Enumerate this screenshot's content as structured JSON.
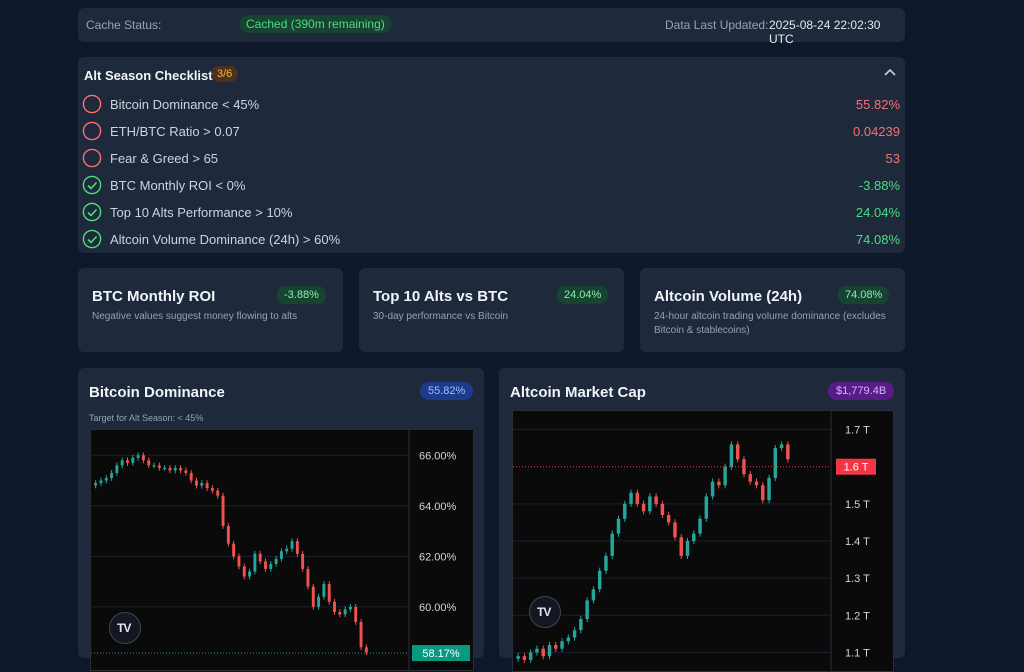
{
  "cache": {
    "status_label": "Cache Status:",
    "status_value": "Cached (390m remaining)",
    "updated_label": "Data Last Updated:",
    "updated_value": "2025-08-24 22:02:30 UTC"
  },
  "checklist": {
    "title": "Alt Season Checklist",
    "count": "3/6",
    "items": [
      {
        "label": "Bitcoin Dominance < 45%",
        "value": "55.82%",
        "met": false
      },
      {
        "label": "ETH/BTC Ratio > 0.07",
        "value": "0.04239",
        "met": false
      },
      {
        "label": "Fear & Greed > 65",
        "value": "53",
        "met": false
      },
      {
        "label": "BTC Monthly ROI < 0%",
        "value": "-3.88%",
        "met": true
      },
      {
        "label": "Top 10 Alts Performance > 10%",
        "value": "24.04%",
        "met": true
      },
      {
        "label": "Altcoin Volume Dominance (24h) > 60%",
        "value": "74.08%",
        "met": true
      }
    ]
  },
  "cards": [
    {
      "title": "BTC Monthly ROI",
      "badge": "-3.88%",
      "desc": "Negative values suggest money flowing to alts"
    },
    {
      "title": "Top 10 Alts vs BTC",
      "badge": "24.04%",
      "desc": "30-day performance vs Bitcoin"
    },
    {
      "title": "Altcoin Volume (24h)",
      "badge": "74.08%",
      "desc": "24-hour altcoin trading volume dominance (excludes Bitcoin & stablecoins)"
    }
  ],
  "btc_dom": {
    "title": "Bitcoin Dominance",
    "badge": "55.82%",
    "subtitle": "Target for Alt Season: < 45%",
    "axis": [
      "66.00%",
      "64.00%",
      "62.00%",
      "60.00%"
    ],
    "last_label": "58.17%",
    "tv_logo": "TV"
  },
  "alt_cap": {
    "title": "Altcoin Market Cap",
    "badge": "$1,779.4B",
    "axis": [
      "1.7 T",
      "1.5 T",
      "1.4 T",
      "1.3 T",
      "1.2 T",
      "1.1 T"
    ],
    "last_label": "1.6 T",
    "tv_logo": "TV"
  },
  "colors": {
    "up": "#26a69a",
    "down": "#ef5350",
    "good": "#4ade80",
    "bad": "#f87171",
    "panel": "#1e293b",
    "bg": "#0f172a"
  },
  "chart_data": [
    {
      "type": "candlestick",
      "title": "Bitcoin Dominance",
      "ylim": [
        57.5,
        67
      ],
      "yticks": [
        66,
        64,
        62,
        60
      ],
      "last": 58.17,
      "close": [
        64.9,
        65.0,
        65.1,
        65.3,
        65.6,
        65.8,
        65.7,
        65.9,
        66.0,
        65.8,
        65.6,
        65.6,
        65.5,
        65.5,
        65.4,
        65.5,
        65.4,
        65.3,
        65.0,
        64.8,
        64.9,
        64.7,
        64.6,
        64.4,
        63.2,
        62.5,
        62.0,
        61.6,
        61.2,
        61.4,
        62.1,
        61.8,
        61.5,
        61.7,
        61.9,
        62.2,
        62.3,
        62.6,
        62.1,
        61.5,
        60.8,
        60.0,
        60.4,
        60.9,
        60.2,
        59.8,
        59.7,
        59.9,
        60.0,
        59.4,
        58.4,
        58.2
      ],
      "note": "approximate daily closes read from chart"
    },
    {
      "type": "candlestick",
      "title": "Altcoin Market Cap",
      "ylim": [
        1.05,
        1.75
      ],
      "yticks": [
        1.7,
        1.5,
        1.4,
        1.3,
        1.2,
        1.1
      ],
      "unit": "T",
      "last": 1.6,
      "close": [
        1.09,
        1.08,
        1.1,
        1.11,
        1.09,
        1.12,
        1.11,
        1.13,
        1.14,
        1.16,
        1.19,
        1.24,
        1.27,
        1.32,
        1.36,
        1.42,
        1.46,
        1.5,
        1.53,
        1.5,
        1.48,
        1.52,
        1.5,
        1.47,
        1.45,
        1.41,
        1.36,
        1.4,
        1.42,
        1.46,
        1.52,
        1.56,
        1.55,
        1.6,
        1.66,
        1.62,
        1.58,
        1.56,
        1.55,
        1.51,
        1.57,
        1.65,
        1.66,
        1.62
      ]
    }
  ]
}
